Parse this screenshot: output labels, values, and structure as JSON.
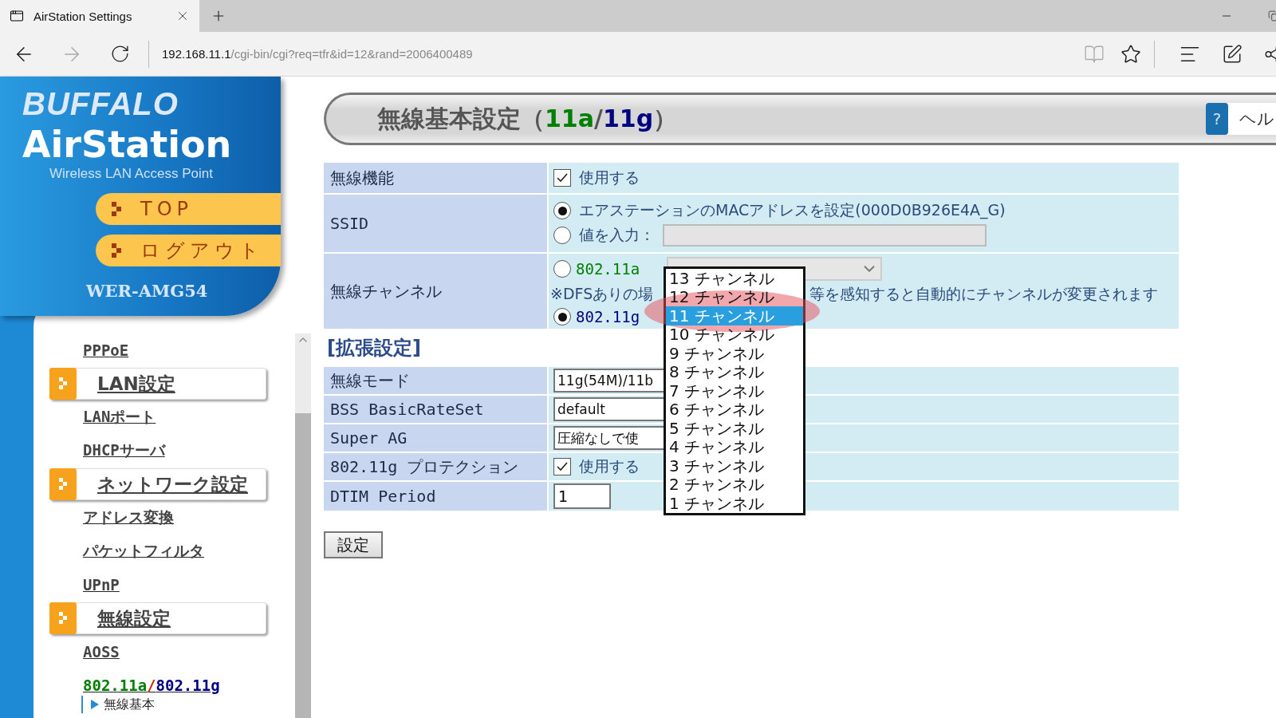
{
  "browser": {
    "tab_title": "AirStation Settings",
    "url": {
      "host": "192.168.11.1",
      "path": "/cgi-bin/cgi?req=tfr&id=12&rand=2006400489"
    }
  },
  "sidebar": {
    "logo_brand": "BUFFALO",
    "logo_product": "AirStation",
    "logo_tagline": "Wireless LAN Access Point",
    "buttons": [
      "TOP",
      "ログアウト"
    ],
    "model": "WER-AMG54",
    "nav": [
      {
        "kind": "link",
        "label": "PPPoE"
      },
      {
        "kind": "section",
        "label": "LAN設定"
      },
      {
        "kind": "link",
        "label": "LANポート"
      },
      {
        "kind": "link",
        "label": "DHCPサーバ"
      },
      {
        "kind": "section",
        "label": "ネットワーク設定"
      },
      {
        "kind": "link",
        "label": "アドレス変換"
      },
      {
        "kind": "link",
        "label": "パケットフィルタ"
      },
      {
        "kind": "link",
        "label": "UPnP"
      },
      {
        "kind": "section",
        "label": "無線設定"
      },
      {
        "kind": "link",
        "label": "AOSS"
      },
      {
        "kind": "band_link",
        "parts": [
          {
            "text": "802.11a",
            "color": "#008000"
          },
          {
            "text": "/",
            "color": "#cc2200"
          },
          {
            "text": "802.11g",
            "color": "#000080"
          }
        ]
      },
      {
        "kind": "sub_link",
        "label": "無線基本"
      }
    ]
  },
  "title": {
    "parts": [
      {
        "text": "無線基本設定（",
        "color": "#555555"
      },
      {
        "text": "11a",
        "color": "#008000"
      },
      {
        "text": "/",
        "color": "#555555"
      },
      {
        "text": "11g",
        "color": "#000080"
      },
      {
        "text": "）",
        "color": "#555555"
      }
    ],
    "help_icon": "?",
    "help": "ヘル"
  },
  "basic_rows": [
    {
      "kind": "checkbox",
      "label": "無線機能",
      "checked": true,
      "text": "使用する"
    },
    {
      "kind": "radio_group",
      "label": "SSID",
      "options": [
        {
          "text": "エアステーションのMACアドレスを設定(000D0B926E4A_G)",
          "selected": true,
          "input": false
        },
        {
          "text": "値を入力：",
          "selected": false,
          "input": true
        }
      ]
    },
    {
      "kind": "channel",
      "label": "無線チャンネル",
      "bands": [
        {
          "text": "802.11a",
          "selected": false,
          "color": "#008000"
        },
        {
          "text": "802.11g",
          "selected": true,
          "color": "#000080"
        }
      ],
      "note_start": "※DFSありの場",
      "note_end": "等を感知すると自動的にチャンネルが変更されます"
    }
  ],
  "extended": {
    "heading": "[拡張設定]",
    "rows": [
      {
        "kind": "select",
        "label": "無線モード",
        "value": "11g(54M)/11b"
      },
      {
        "kind": "select",
        "label": "BSS BasicRateSet",
        "value": "default"
      },
      {
        "kind": "select",
        "label": "Super AG",
        "value": "圧縮なしで使"
      },
      {
        "kind": "checkbox",
        "label": "802.11g プロテクション",
        "checked": true,
        "text": "使用する"
      },
      {
        "kind": "text_input",
        "label": "DTIM Period",
        "value": "1"
      }
    ]
  },
  "submit": "設定",
  "channel_dropdown": {
    "items": [
      {
        "label": "13 チャンネル",
        "selected": false
      },
      {
        "label": "12 チャンネル",
        "selected": false
      },
      {
        "label": "11 チャンネル",
        "selected": true
      },
      {
        "label": "10 チャンネル",
        "selected": false
      },
      {
        "label": "9 チャンネル",
        "selected": false
      },
      {
        "label": "8 チャンネル",
        "selected": false
      },
      {
        "label": "7 チャンネル",
        "selected": false
      },
      {
        "label": "6 チャンネル",
        "selected": false
      },
      {
        "label": "5 チャンネル",
        "selected": false
      },
      {
        "label": "4 チャンネル",
        "selected": false
      },
      {
        "label": "3 チャンネル",
        "selected": false
      },
      {
        "label": "2 チャンネル",
        "selected": false
      },
      {
        "label": "1 チャンネル",
        "selected": false
      }
    ]
  }
}
